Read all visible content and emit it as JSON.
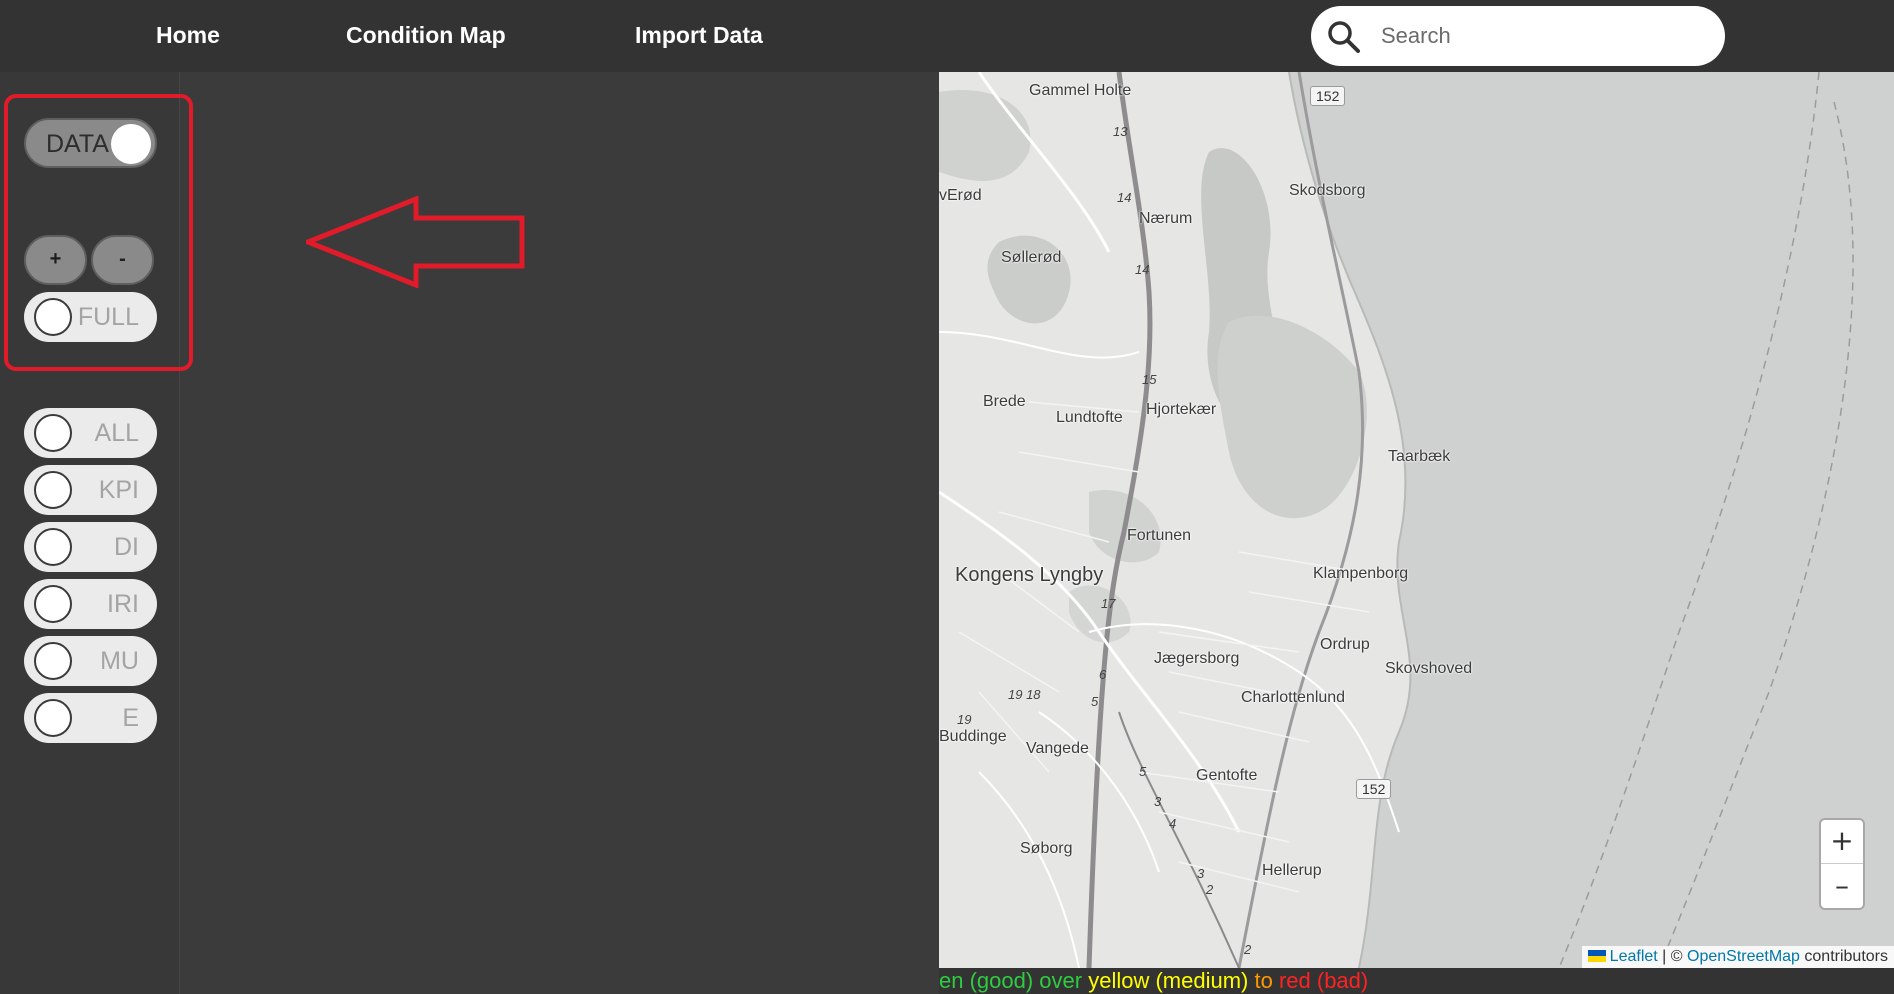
{
  "nav": {
    "home": "Home",
    "condition_map": "Condition Map",
    "import_data": "Import Data",
    "search_placeholder": "Search"
  },
  "sidebar": {
    "data_toggle": "DATA",
    "zoom_in": "+",
    "zoom_out": "-",
    "full_toggle": "FULL",
    "layers": [
      {
        "label": "ALL"
      },
      {
        "label": "KPI"
      },
      {
        "label": "DI"
      },
      {
        "label": "IRI"
      },
      {
        "label": "MU"
      },
      {
        "label": "E"
      }
    ]
  },
  "map": {
    "places": {
      "gammel_holte": "Gammel Holte",
      "vaerod": "vErød",
      "naerum": "Nærum",
      "skodsborg": "Skodsborg",
      "sollerod": "Søllerød",
      "brede": "Brede",
      "lundtofte": "Lundtofte",
      "hjortekaer": "Hjortekær",
      "taarbaek": "Taarbæk",
      "fortunen": "Fortunen",
      "kongens_lyngby": "Kongens Lyngby",
      "klampenborg": "Klampenborg",
      "ordrup": "Ordrup",
      "jaegersborg": "Jægersborg",
      "skovshoved": "Skovshoved",
      "charlottenlund": "Charlottenlund",
      "buddinge": "Buddinge",
      "vangede": "Vangede",
      "gentofte": "Gentofte",
      "soborg": "Søborg",
      "hellerup": "Hellerup"
    },
    "shields": {
      "road152_top": "152",
      "road152_bottom": "152"
    },
    "road_numbers": {
      "r13": "13",
      "r14a": "14",
      "r14b": "14",
      "r15": "15",
      "r17": "17",
      "r6": "6",
      "r5a": "5",
      "r1918": "19 18",
      "r19": "19",
      "r5b": "5",
      "r3a": "3",
      "r4": "4",
      "r3b": "3",
      "r2a": "2",
      "r2b": "2"
    },
    "zoom_in": "+",
    "zoom_out": "–",
    "attribution": {
      "leaflet": "Leaflet",
      "separator": " | © ",
      "osm": "OpenStreetMap",
      "contributors": " contributors"
    }
  },
  "legend": {
    "green": "en (good)",
    "over": " over ",
    "yellow": "yellow (medium)",
    "to": " to ",
    "red": "red (bad)",
    "colors": {
      "green": "#2ecc40",
      "yellow": "#ffff00",
      "orange": "#ff9800",
      "red": "#ff2222"
    }
  },
  "colors": {
    "highlight": "#e21b2a",
    "topbar": "#333333"
  }
}
